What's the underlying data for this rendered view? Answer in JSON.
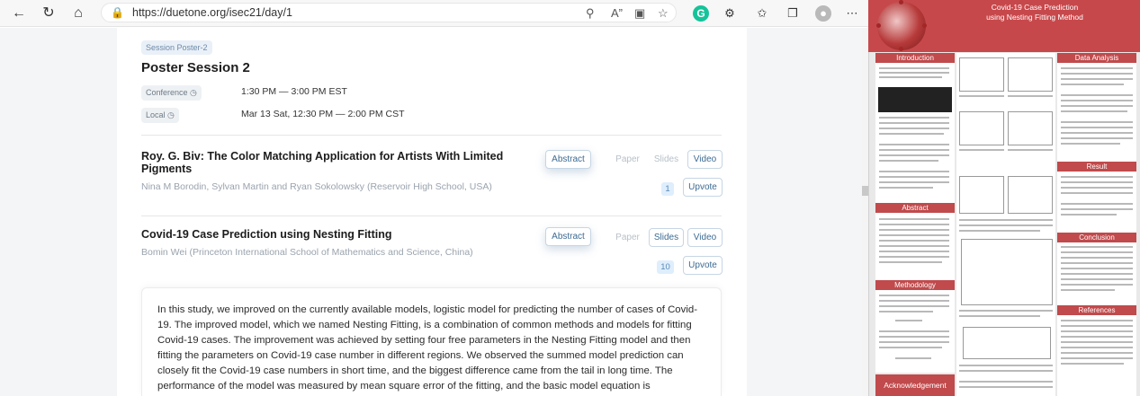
{
  "browser": {
    "url": "https://duetone.org/isec21/day/1",
    "icons": [
      "back-icon",
      "refresh-icon",
      "home-icon",
      "lock-icon",
      "key-icon",
      "read-aloud-icon",
      "app-icon",
      "favorite-icon",
      "grammarly-icon",
      "extensions-icon",
      "favorites-icon",
      "collections-icon",
      "profile-icon",
      "more-icon"
    ],
    "grammarly_letter": "G"
  },
  "session": {
    "badge": "Session Poster-2",
    "title": "Poster Session 2",
    "conference_label": "Conference",
    "conference_time": "1:30 PM — 3:00 PM EST",
    "local_label": "Local",
    "local_time": "Mar 13 Sat, 12:30 PM — 2:00 PM CST"
  },
  "papers": [
    {
      "title_line1": "Roy. G. Biv: The Color Matching Application for Artists With Limited",
      "title_line2": "Pigments",
      "authors": "Nina M Borodin, Sylvan Martin and Ryan Sokolowsky (Reservoir High School, USA)",
      "abstract_btn": "Abstract",
      "paper_btn": "Paper",
      "slides_btn": "Slides",
      "video_btn": "Video",
      "votes": "1",
      "upvote_btn": "Upvote"
    },
    {
      "title_line1": "Covid-19 Case Prediction using Nesting Fitting",
      "authors": "Bomin Wei (Princeton International School of Mathematics and Science, China)",
      "abstract_btn": "Abstract",
      "paper_btn": "Paper",
      "slides_btn": "Slides",
      "video_btn": "Video",
      "votes": "10",
      "upvote_btn": "Upvote"
    }
  ],
  "abstract": {
    "text": "In this study, we improved on the currently available models, logistic model for predicting the number of cases of Covid-19. The improved model, which we named Nesting Fitting, is a combination of common methods and models for fitting Covid-19 cases. The improvement was achieved by setting four free parameters in the Nesting Fitting model and then fitting the parameters on Covid-19 case number in different regions. We observed the summed model prediction can closely fit the Covid-19 case numbers in short time, and the biggest difference came from the tail in long time. The performance of the model was measured by mean square error of the fitting, and the basic model equation is"
  },
  "poster": {
    "title_line1": "Covid-19 Case Prediction",
    "title_line2": "using Nesting Fitting Method",
    "headers": [
      "Introduction",
      "Data Analysis",
      "Result",
      "Abstract",
      "Conclusion",
      "Methodology",
      "References",
      "Acknowledgement"
    ]
  }
}
